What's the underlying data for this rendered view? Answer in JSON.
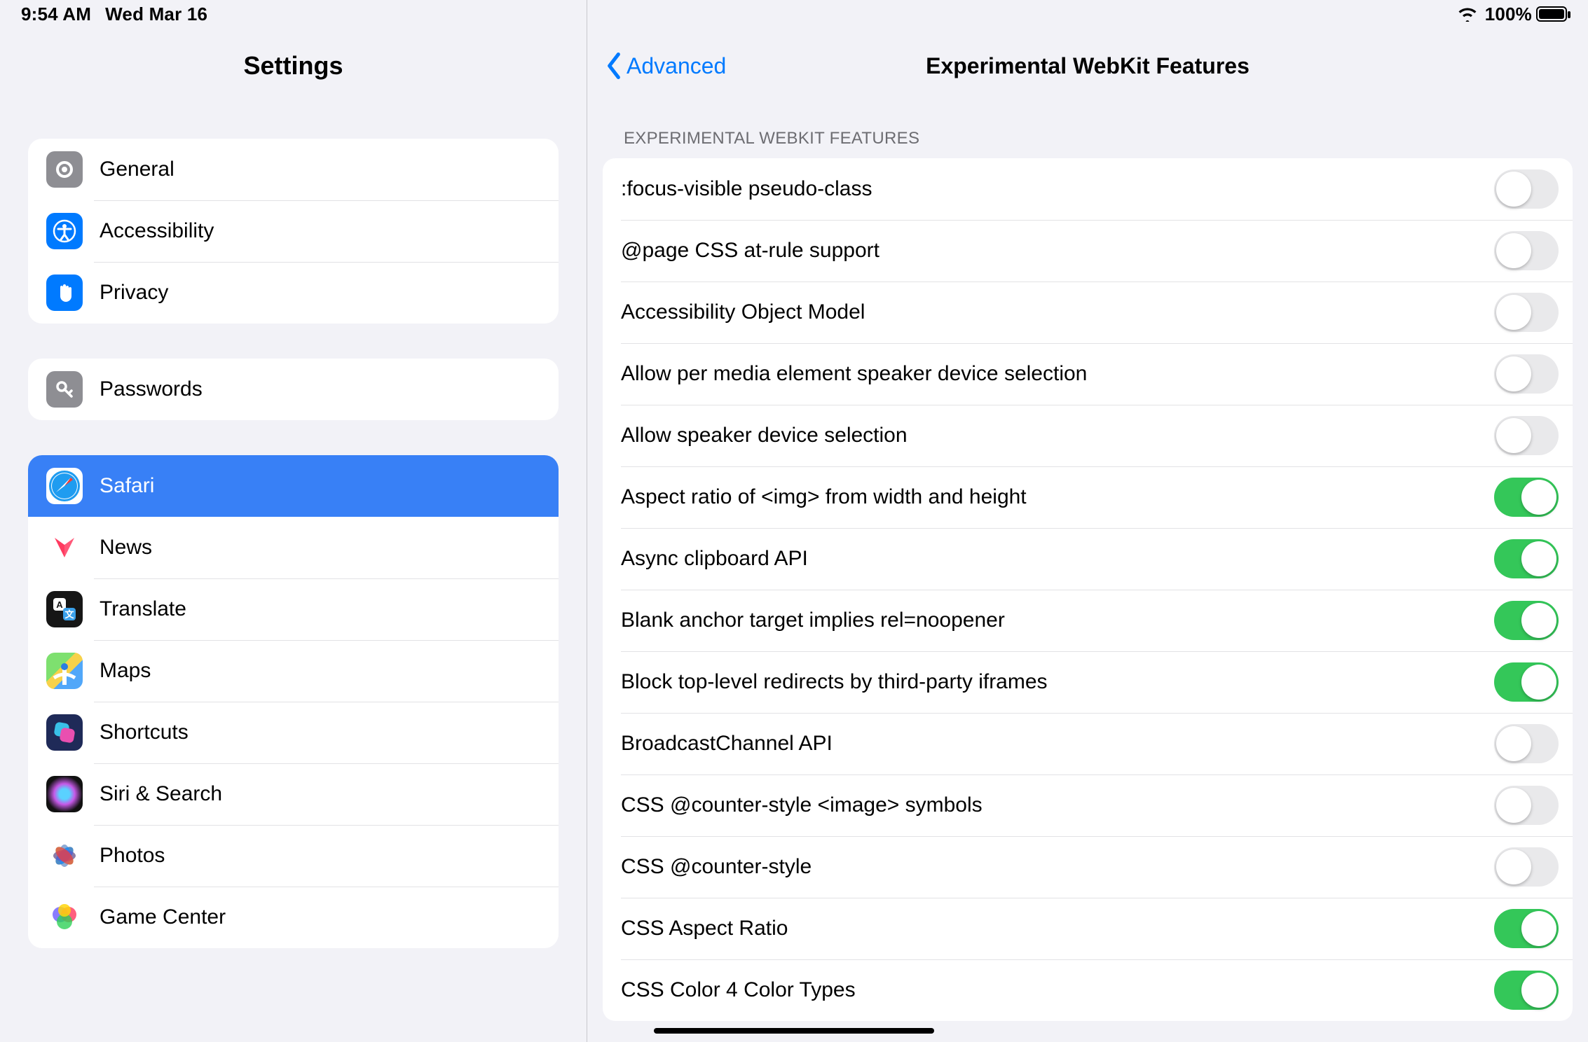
{
  "status": {
    "time": "9:54 AM",
    "date": "Wed Mar 16",
    "battery_pct": "100%"
  },
  "sidebar": {
    "title": "Settings",
    "groups": [
      {
        "items": [
          {
            "key": "general",
            "label": "General",
            "icon": "gear-icon",
            "iconClass": "ic-gear"
          },
          {
            "key": "accessibility",
            "label": "Accessibility",
            "icon": "accessibility-icon",
            "iconClass": "ic-access"
          },
          {
            "key": "privacy",
            "label": "Privacy",
            "icon": "hand-icon",
            "iconClass": "ic-privacy"
          }
        ]
      },
      {
        "items": [
          {
            "key": "passwords",
            "label": "Passwords",
            "icon": "key-icon",
            "iconClass": "ic-key"
          }
        ]
      },
      {
        "items": [
          {
            "key": "safari",
            "label": "Safari",
            "icon": "safari-icon",
            "iconClass": "ic-safari",
            "selected": true
          },
          {
            "key": "news",
            "label": "News",
            "icon": "news-icon",
            "iconClass": "ic-news"
          },
          {
            "key": "translate",
            "label": "Translate",
            "icon": "translate-icon",
            "iconClass": "ic-translate"
          },
          {
            "key": "maps",
            "label": "Maps",
            "icon": "maps-icon",
            "iconClass": "ic-maps"
          },
          {
            "key": "shortcuts",
            "label": "Shortcuts",
            "icon": "shortcuts-icon",
            "iconClass": "ic-shortcuts"
          },
          {
            "key": "siri",
            "label": "Siri & Search",
            "icon": "siri-icon",
            "iconClass": "ic-siri"
          },
          {
            "key": "photos",
            "label": "Photos",
            "icon": "photos-icon",
            "iconClass": "ic-photos"
          },
          {
            "key": "gamecenter",
            "label": "Game Center",
            "icon": "gamecenter-icon",
            "iconClass": "ic-gamecenter"
          }
        ]
      }
    ]
  },
  "main": {
    "back_label": "Advanced",
    "title": "Experimental WebKit Features",
    "section_header": "EXPERIMENTAL WEBKIT FEATURES",
    "features": [
      {
        "label": ":focus-visible pseudo-class",
        "on": false
      },
      {
        "label": "@page CSS at-rule support",
        "on": false
      },
      {
        "label": "Accessibility Object Model",
        "on": false
      },
      {
        "label": "Allow per media element speaker device selection",
        "on": false
      },
      {
        "label": "Allow speaker device selection",
        "on": false
      },
      {
        "label": "Aspect ratio of <img> from width and height",
        "on": true
      },
      {
        "label": "Async clipboard API",
        "on": true
      },
      {
        "label": "Blank anchor target implies rel=noopener",
        "on": true
      },
      {
        "label": "Block top-level redirects by third-party iframes",
        "on": true
      },
      {
        "label": "BroadcastChannel API",
        "on": false
      },
      {
        "label": "CSS @counter-style <image> symbols",
        "on": false
      },
      {
        "label": "CSS @counter-style",
        "on": false
      },
      {
        "label": "CSS Aspect Ratio",
        "on": true
      },
      {
        "label": "CSS Color 4 Color Types",
        "on": true
      }
    ]
  }
}
